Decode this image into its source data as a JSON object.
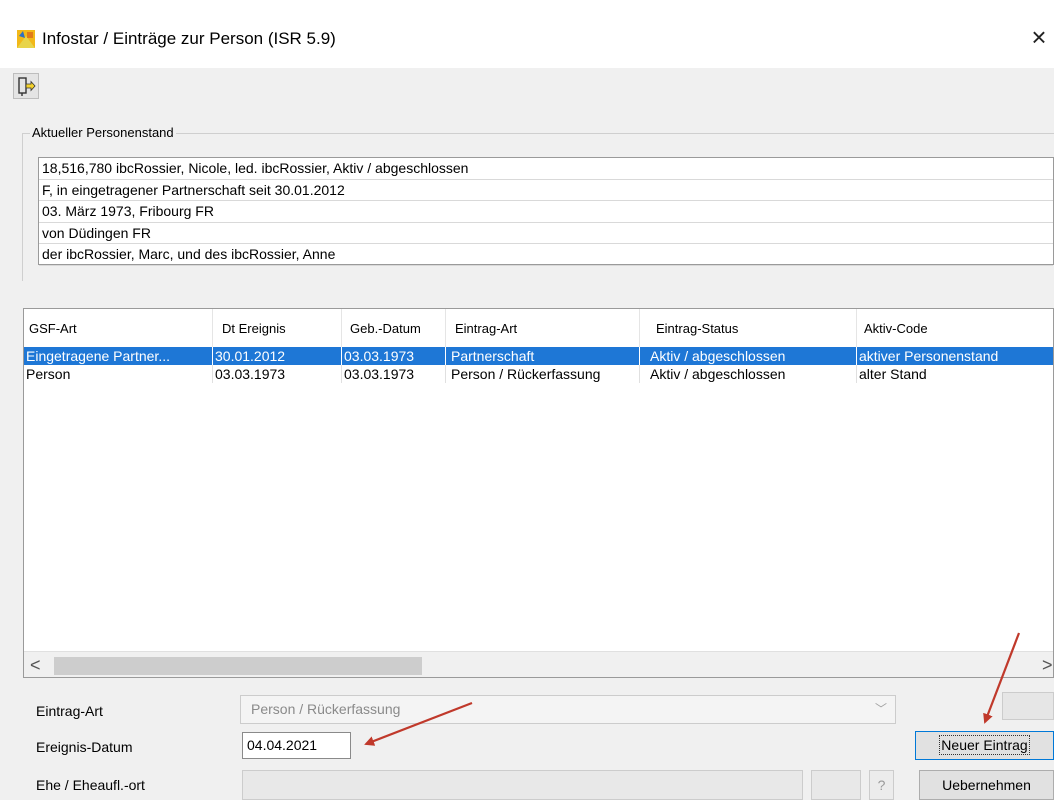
{
  "window": {
    "title": "Infostar / Einträge zur Person (ISR 5.9)",
    "close_glyph": "×",
    "icons": {
      "app": "infostar-app-icon",
      "close": "close-icon",
      "toolbar": "exit-door-icon"
    }
  },
  "personenstand": {
    "group_label": "Aktueller Personenstand",
    "lines": [
      "18,516,780  ibcRossier, Nicole, led. ibcRossier, Aktiv / abgeschlossen",
      "F, in eingetragener Partnerschaft seit 30.01.2012",
      "03. März 1973, Fribourg FR",
      "von Düdingen FR",
      "der ibcRossier, Marc, und des ibcRossier, Anne"
    ]
  },
  "table": {
    "columns": [
      "GSF-Art",
      "Dt Ereignis",
      "Geb.-Datum",
      "Eintrag-Art",
      "Eintrag-Status",
      "Aktiv-Code"
    ],
    "rows": [
      {
        "selected": true,
        "cells": [
          "Eingetragene Partner...",
          "30.01.2012",
          "03.03.1973",
          "Partnerschaft",
          "Aktiv / abgeschlossen",
          "aktiver Personenstand"
        ]
      },
      {
        "selected": false,
        "cells": [
          "Person",
          "03.03.1973",
          "03.03.1973",
          "Person / Rückerfassung",
          "Aktiv / abgeschlossen",
          "alter Stand"
        ]
      }
    ],
    "scroll_left": "<",
    "scroll_right": ">"
  },
  "form": {
    "eintrag_art": {
      "label": "Eintrag-Art",
      "value": "Person / Rückerfassung",
      "arrow": "﹀"
    },
    "ereignis_datum": {
      "label": "Ereignis-Datum",
      "value": "04.04.2021"
    },
    "ehe_ort": {
      "label": "Ehe / Eheaufl.-ort",
      "value": "",
      "help": "?"
    }
  },
  "buttons": {
    "neuer_eintrag": "Neuer Eintrag",
    "uebernehmen": "Uebernehmen"
  },
  "colors": {
    "selection": "#1e77d6",
    "annotation_arrow": "#c0392b"
  }
}
